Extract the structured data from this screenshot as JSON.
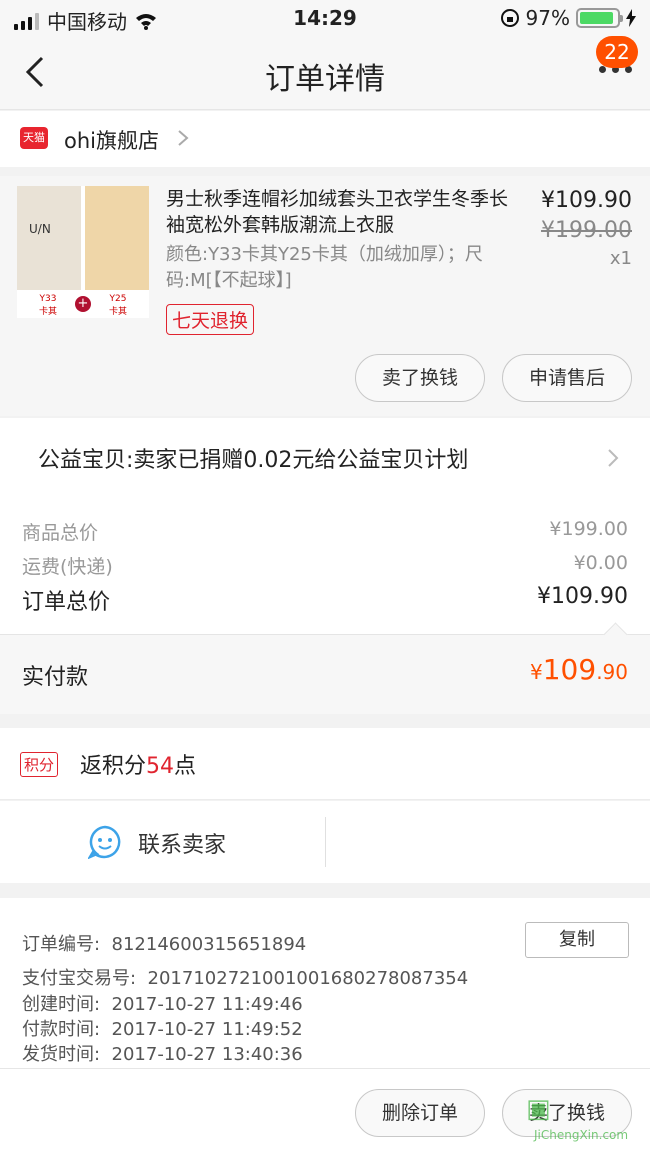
{
  "status_bar": {
    "carrier": "中国移动",
    "time": "14:29",
    "battery": "97%"
  },
  "nav": {
    "title": "订单详情",
    "badge": "22"
  },
  "shop": {
    "logo": "天猫",
    "name": "ohi旗舰店"
  },
  "product": {
    "title": "男士秋季连帽衫加绒套头卫衣学生冬季长袖宽松外套韩版潮流上衣服",
    "attributes": "颜色:Y33卡其Y25卡其（加绒加厚）；尺码:M[【不起球】]",
    "price": "¥109.90",
    "original_price": "¥199.00",
    "quantity": "x1",
    "return_badge": "七天退换",
    "thumb_labels": [
      "Y33\n卡其",
      "Y25\n卡其"
    ],
    "buttons": {
      "sell": "卖了换钱",
      "after_sale": "申请售后"
    }
  },
  "charity": {
    "text": "公益宝贝:卖家已捐赠0.02元给公益宝贝计划"
  },
  "prices": {
    "items": [
      {
        "label": "商品总价",
        "value": "¥199.00"
      },
      {
        "label": "运费(快递)",
        "value": "¥0.00"
      },
      {
        "label": "订单总价",
        "value": "¥109.90"
      }
    ],
    "paid": {
      "label": "实付款",
      "currency": "¥",
      "integer": "109",
      "decimal": ".90"
    }
  },
  "points": {
    "tag": "积分",
    "prefix": "返积分",
    "value": "54",
    "suffix": "点"
  },
  "contact": {
    "label": "联系卖家"
  },
  "order_info": {
    "copy_label": "复制",
    "lines": [
      {
        "label": "订单编号:",
        "value": "81214600315651894"
      },
      {
        "label": "支付宝交易号:",
        "value": "2017102721001001680278087354"
      },
      {
        "label": "创建时间:",
        "value": "2017-10-27 11:49:46"
      },
      {
        "label": "付款时间:",
        "value": "2017-10-27 11:49:52"
      },
      {
        "label": "发货时间:",
        "value": "2017-10-27 13:40:36"
      }
    ]
  },
  "bottom": {
    "delete": "删除订单",
    "sell": "卖了换钱"
  },
  "watermark": {
    "text": "JiChengXin.com"
  },
  "colors": {
    "accent": "#ff5000",
    "tmall_red": "#e0242f",
    "battery_green": "#4cd964"
  }
}
